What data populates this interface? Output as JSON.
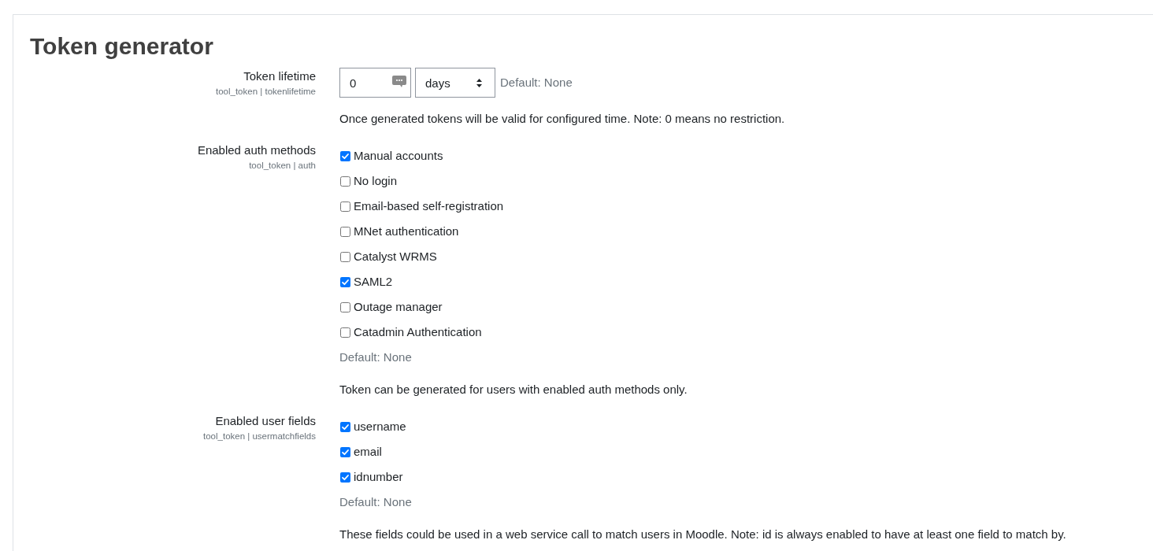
{
  "heading": "Token generator",
  "settings": [
    {
      "kind": "duration",
      "label": "Token lifetime",
      "config_name": "tool_token | tokenlifetime",
      "value": "0",
      "unit": "days",
      "default": "Default: None",
      "description": "Once generated tokens will be valid for configured time. Note: 0 means no restriction."
    },
    {
      "kind": "checklist",
      "label": "Enabled auth methods",
      "config_name": "tool_token | auth",
      "options": [
        {
          "label": "Manual accounts",
          "checked": true
        },
        {
          "label": "No login",
          "checked": false
        },
        {
          "label": "Email-based self-registration",
          "checked": false
        },
        {
          "label": "MNet authentication",
          "checked": false
        },
        {
          "label": "Catalyst WRMS",
          "checked": false
        },
        {
          "label": "SAML2",
          "checked": true
        },
        {
          "label": "Outage manager",
          "checked": false
        },
        {
          "label": "Catadmin Authentication",
          "checked": false
        }
      ],
      "default": "Default: None",
      "description": "Token can be generated for users with enabled auth methods only."
    },
    {
      "kind": "checklist",
      "label": "Enabled user fields",
      "config_name": "tool_token | usermatchfields",
      "options": [
        {
          "label": "username",
          "checked": true
        },
        {
          "label": "email",
          "checked": true
        },
        {
          "label": "idnumber",
          "checked": true
        }
      ],
      "default": "Default: None",
      "description": "These fields could be used in a web service call to match users in Moodle. Note: id is always enabled to have at least one field to match by."
    }
  ]
}
